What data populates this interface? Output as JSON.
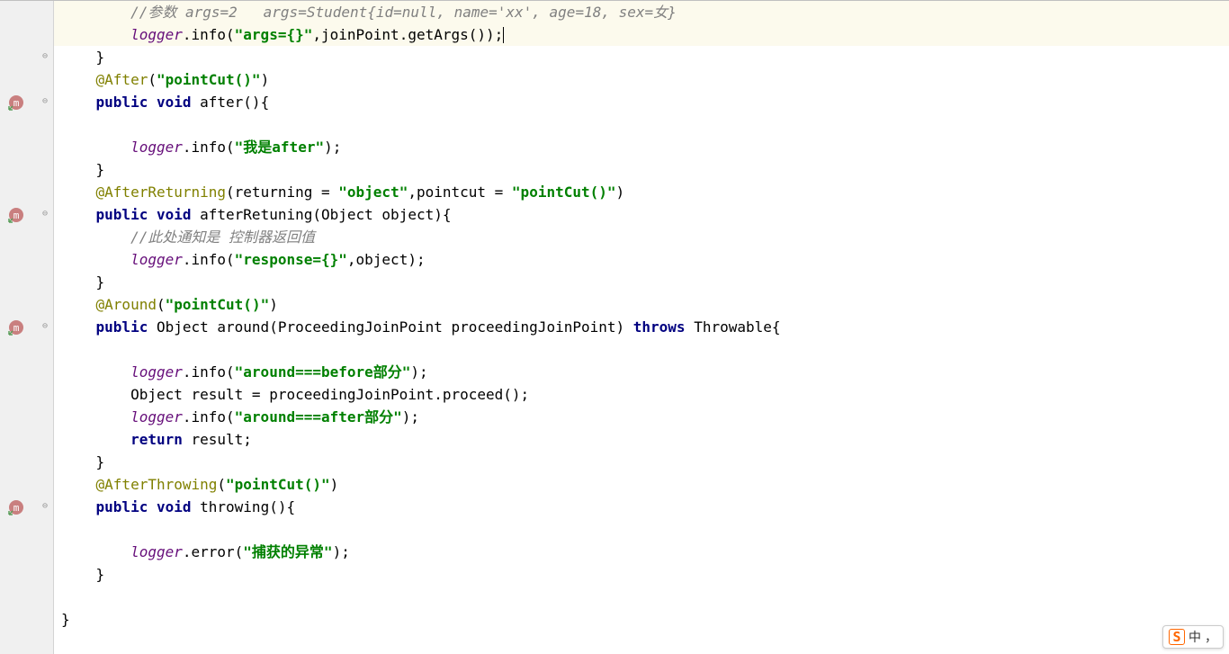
{
  "code": {
    "line1_comment": "//参数 args=2   args=Student{id=null, name='xx', age=18, sex=女}",
    "line2_logger": "logger",
    "line2_info": ".info(",
    "line2_str": "\"args={}\"",
    "line2_rest": ",joinPoint.getArgs());",
    "line3": "    }",
    "line4_anno": "@After",
    "line4_paren": "(",
    "line4_str": "\"pointCut()\"",
    "line4_close": ")",
    "line5_kw1": "public",
    "line5_kw2": "void",
    "line5_rest": " after(){",
    "line7_logger": "logger",
    "line7_info": ".info(",
    "line7_str": "\"我是after\"",
    "line7_close": ");",
    "line8": "    }",
    "line9_anno": "@AfterReturning",
    "line9_paren": "(returning = ",
    "line9_str1": "\"object\"",
    "line9_mid": ",pointcut = ",
    "line9_str2": "\"pointCut()\"",
    "line9_close": ")",
    "line10_kw1": "public",
    "line10_kw2": "void",
    "line10_rest": " afterRetuning(Object object){",
    "line11_comment": "//此处通知是 控制器返回值",
    "line12_logger": "logger",
    "line12_info": ".info(",
    "line12_str": "\"response={}\"",
    "line12_close": ",object);",
    "line13": "    }",
    "line14_anno": "@Around",
    "line14_paren": "(",
    "line14_str": "\"pointCut()\"",
    "line14_close": ")",
    "line15_kw1": "public",
    "line15_rest1": " Object around(ProceedingJoinPoint proceedingJoinPoint) ",
    "line15_kw2": "throws",
    "line15_rest2": " Throwable{",
    "line17_logger": "logger",
    "line17_info": ".info(",
    "line17_str": "\"around===before部分\"",
    "line17_close": ");",
    "line18": "        Object result = proceedingJoinPoint.proceed();",
    "line19_logger": "logger",
    "line19_info": ".info(",
    "line19_str": "\"around===after部分\"",
    "line19_close": ");",
    "line20_kw": "return",
    "line20_rest": " result;",
    "line21": "    }",
    "line22_anno": "@AfterThrowing",
    "line22_paren": "(",
    "line22_str": "\"pointCut()\"",
    "line22_close": ")",
    "line23_kw1": "public",
    "line23_kw2": "void",
    "line23_rest": " throwing(){",
    "line25_logger": "logger",
    "line25_info": ".error(",
    "line25_str": "\"捕获的异常\"",
    "line25_close": ");",
    "line26": "    }",
    "line28": "}"
  },
  "ime": {
    "label": "中",
    "punct": "，"
  }
}
